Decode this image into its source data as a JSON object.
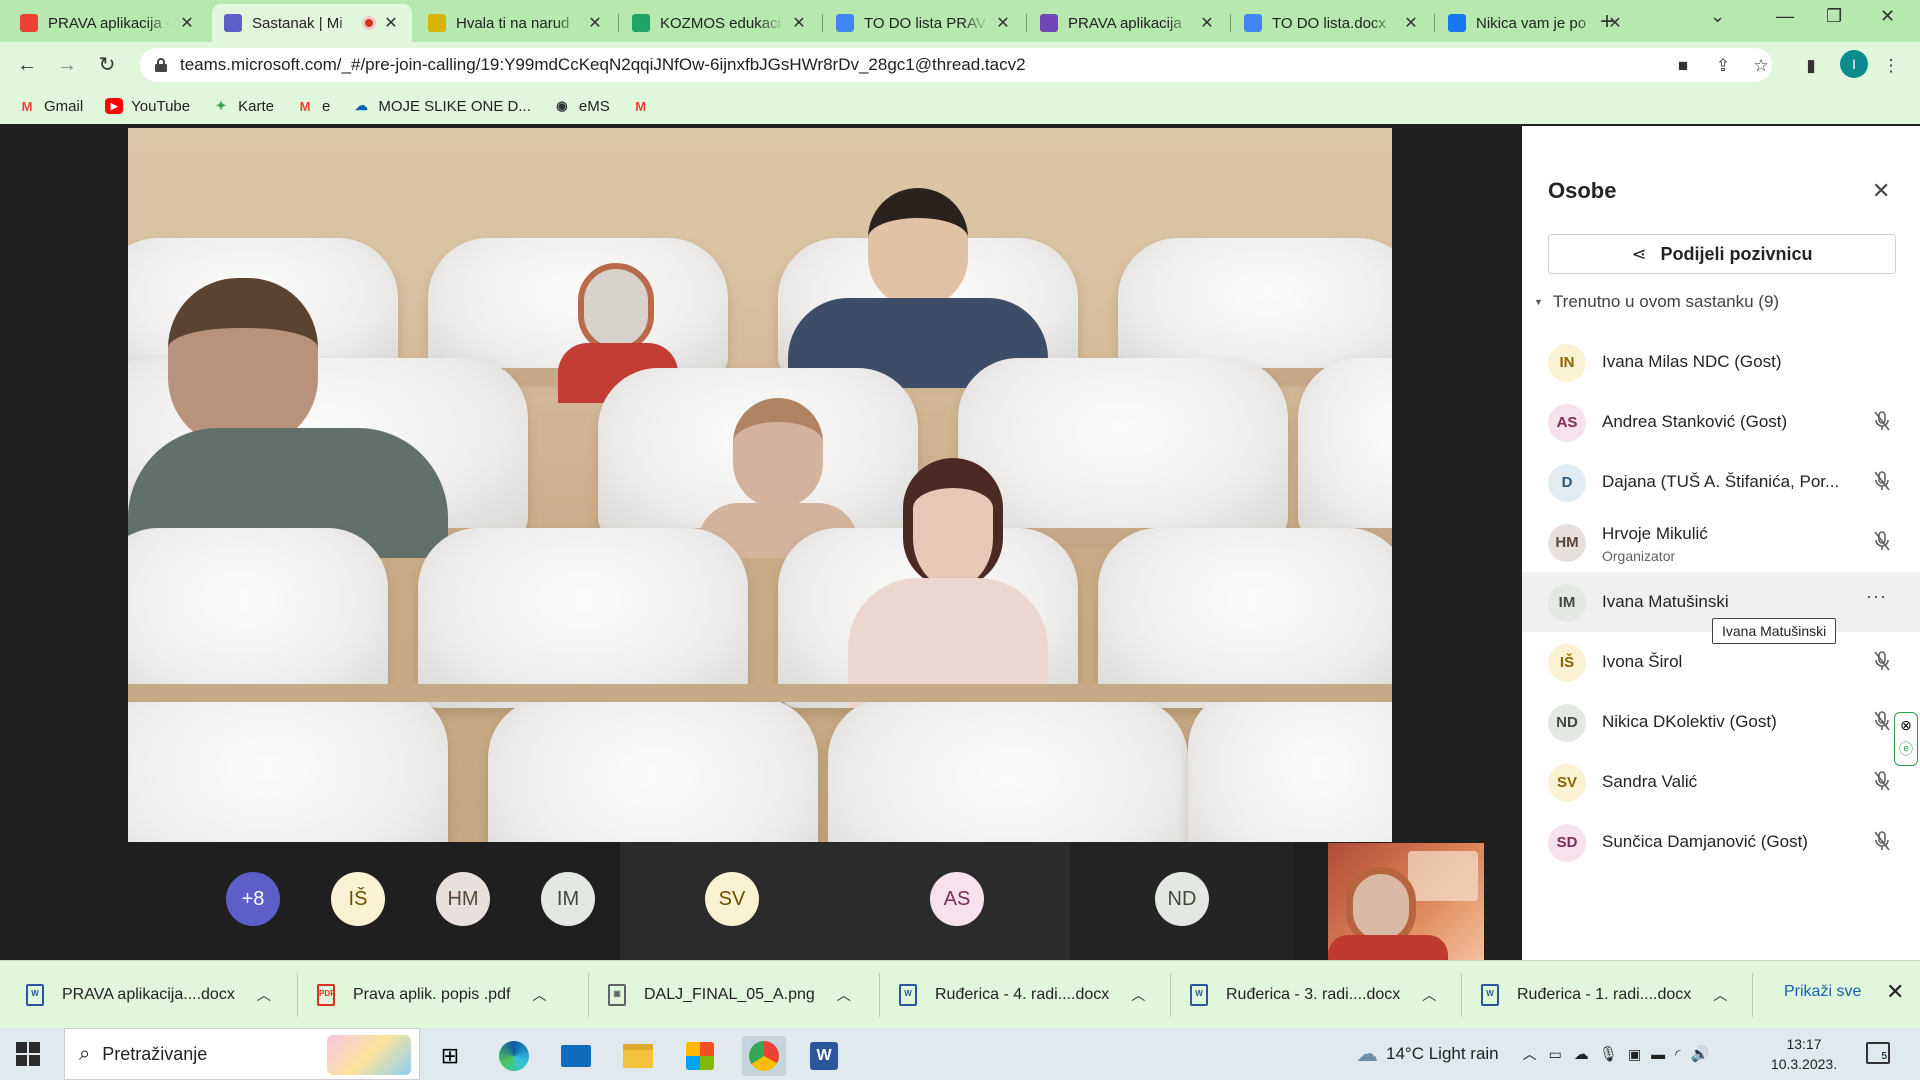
{
  "browser": {
    "tabs": [
      {
        "title": "PRAVA aplikacija - ",
        "icon": "gmail-icon",
        "color": "#ea4335"
      },
      {
        "title": "Sastanak | Mi",
        "icon": "teams-icon",
        "color": "#5b5fc7",
        "active": true
      },
      {
        "title": "Hvala ti na narud",
        "icon": "ticket-icon",
        "color": "#d6b400"
      },
      {
        "title": "KOZMOS edukaci",
        "icon": "google-drive-icon",
        "color": "#1fa463"
      },
      {
        "title": "TO DO lista PRAV",
        "icon": "google-docs-icon",
        "color": "#4285f4"
      },
      {
        "title": "PRAVA aplikacija",
        "icon": "google-forms-icon",
        "color": "#7248b9"
      },
      {
        "title": "TO DO lista.docx",
        "icon": "google-docs-icon",
        "color": "#4285f4"
      },
      {
        "title": "Nikica vam je po",
        "icon": "facebook-icon",
        "color": "#1877f2"
      }
    ],
    "url": "teams.microsoft.com/_#/pre-join-calling/19:Y99mdCcKeqN2qqiJNfOw-6ijnxfbJGsHWr8rDv_28gc1@thread.tacv2",
    "profile_initial": "I",
    "bookmarks": [
      {
        "label": "Gmail",
        "icon": "gmail-icon"
      },
      {
        "label": "YouTube",
        "icon": "youtube-icon"
      },
      {
        "label": "Karte",
        "icon": "maps-icon"
      },
      {
        "label": "e",
        "icon": "gmail-icon"
      },
      {
        "label": "MOJE SLIKE ONE D...",
        "icon": "onedrive-icon"
      },
      {
        "label": "eMS",
        "icon": "globe-icon"
      },
      {
        "label": "",
        "icon": "gmail-icon"
      }
    ]
  },
  "meeting": {
    "roster": [
      {
        "initials": "+8",
        "bg": "#5b5fc7",
        "fg": "#ffffff"
      },
      {
        "initials": "IŠ",
        "bg": "#fbf1d3",
        "fg": "#6b4e00"
      },
      {
        "initials": "HM",
        "bg": "#e8e0dc",
        "fg": "#5a463c"
      },
      {
        "initials": "IM",
        "bg": "#e4e8e2",
        "fg": "#3f4a3c"
      },
      {
        "initials": "SV",
        "bg": "#fbf1d3",
        "fg": "#6b4e00"
      },
      {
        "initials": "AS",
        "bg": "#f6e1ec",
        "fg": "#7a2d56"
      },
      {
        "initials": "ND",
        "bg": "#e4e8e2",
        "fg": "#3f4a3c"
      }
    ]
  },
  "people_panel": {
    "title": "Osobe",
    "share_label": "Podijeli pozivnicu",
    "group_label": "Trenutno u ovom sastanku (9)",
    "participants": [
      {
        "initials": "IN",
        "name": "Ivana Milas NDC (Gost)",
        "bg": "#fbf1d3",
        "fg": "#8a6400",
        "muted": false
      },
      {
        "initials": "AS",
        "name": "Andrea Stanković (Gost)",
        "bg": "#f6e1ec",
        "fg": "#7a2d56",
        "muted": true
      },
      {
        "initials": "D",
        "name": "Dajana (TUŠ A. Štifanića, Por...",
        "bg": "#e0ecf2",
        "fg": "#2d5570",
        "muted": true
      },
      {
        "initials": "HM",
        "name": "Hrvoje Mikulić",
        "role": "Organizator",
        "bg": "#e8e0dc",
        "fg": "#5a463c",
        "muted": true
      },
      {
        "initials": "IM",
        "name": "Ivana Matušinski",
        "bg": "#e4e8e2",
        "fg": "#3f4a3c",
        "muted": false,
        "hover": true
      },
      {
        "initials": "IŠ",
        "name": "Ivona Širol",
        "bg": "#fbf1d3",
        "fg": "#8a6400",
        "muted": true
      },
      {
        "initials": "ND",
        "name": "Nikica DKolektiv (Gost)",
        "bg": "#e4e8e2",
        "fg": "#3f4a3c",
        "muted": true
      },
      {
        "initials": "SV",
        "name": "Sandra Valić",
        "bg": "#fbf1d3",
        "fg": "#8a6400",
        "muted": true
      },
      {
        "initials": "SD",
        "name": "Sunčica Damjanović (Gost)",
        "bg": "#f6e1ec",
        "fg": "#7a2d56",
        "muted": true
      }
    ],
    "tooltip": "Ivana Matušinski"
  },
  "downloads": {
    "items": [
      {
        "name": "PRAVA aplikacija....docx",
        "type": "word",
        "color": "#2b579a"
      },
      {
        "name": "Prava aplik. popis .pdf",
        "type": "pdf",
        "color": "#d93025"
      },
      {
        "name": "DALJ_FINAL_05_A.png",
        "type": "image",
        "color": "#5f6368"
      },
      {
        "name": "Ruđerica - 4. radi....docx",
        "type": "word",
        "color": "#2b579a"
      },
      {
        "name": "Ruđerica - 3. radi....docx",
        "type": "word",
        "color": "#2b579a"
      },
      {
        "name": "Ruđerica - 1. radi....docx",
        "type": "word",
        "color": "#2b579a"
      }
    ],
    "show_all": "Prikaži sve"
  },
  "taskbar": {
    "search_placeholder": "Pretraživanje",
    "weather": "14°C  Light rain",
    "time": "13:17",
    "date": "10.3.2023.",
    "notification_count": "5"
  }
}
